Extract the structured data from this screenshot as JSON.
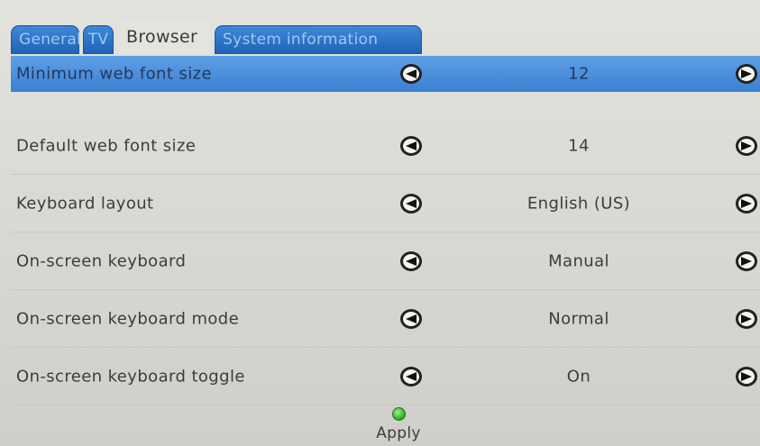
{
  "tabs": [
    {
      "label": "General",
      "state": "inactive"
    },
    {
      "label": "TV",
      "state": "inactive"
    },
    {
      "label": "Browser",
      "state": "active"
    },
    {
      "label": "System information",
      "state": "inactive"
    }
  ],
  "settings": [
    {
      "label": "Minimum web font size",
      "value": "12",
      "selected": true
    },
    {
      "label": "Default web font size",
      "value": "14",
      "selected": false
    },
    {
      "label": "Keyboard layout",
      "value": "English (US)",
      "selected": false
    },
    {
      "label": "On-screen keyboard",
      "value": "Manual",
      "selected": false
    },
    {
      "label": "On-screen keyboard mode",
      "value": "Normal",
      "selected": false
    },
    {
      "label": "On-screen keyboard toggle",
      "value": "On",
      "selected": false
    }
  ],
  "icons": {
    "left": "arrow-left-icon",
    "right": "arrow-right-icon",
    "apply": "green-led-icon"
  },
  "apply": {
    "label": "Apply"
  },
  "colors": {
    "tab_active_bg": "#e4e4df",
    "tab_inactive_bg": "#2f78cc",
    "selected_row_bg": "#4b8ed9",
    "apply_led": "#3dbb2e"
  }
}
